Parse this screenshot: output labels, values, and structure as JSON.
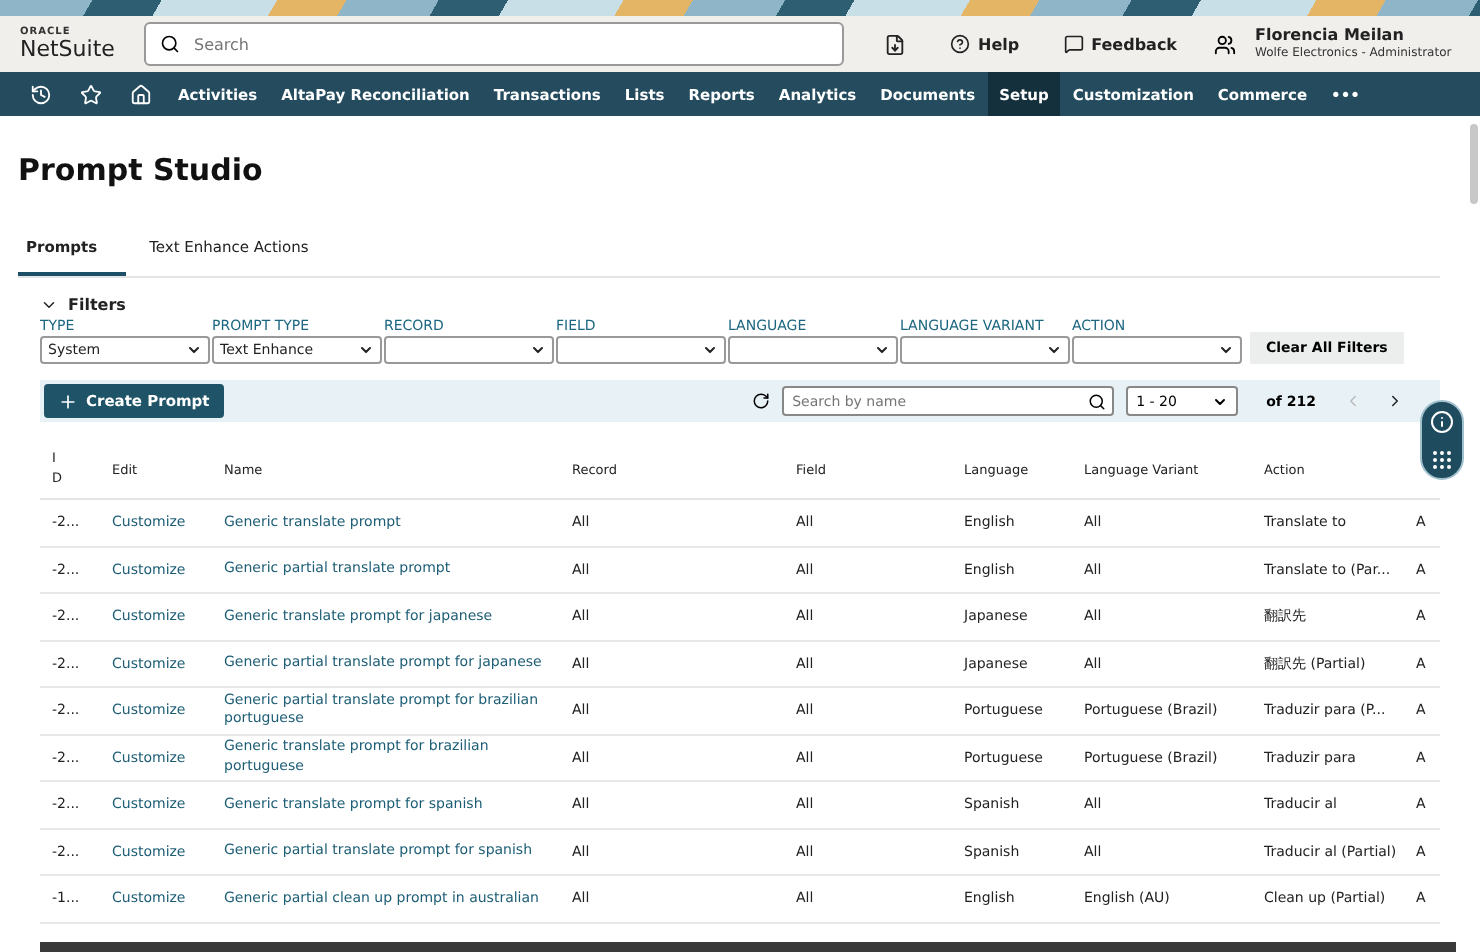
{
  "header": {
    "logo_top": "ORACLE",
    "logo": "NetSuite",
    "search": {
      "placeholder": "Search"
    },
    "help": "Help",
    "feedback": "Feedback",
    "user": {
      "name": "Florencia Meilan",
      "role": "Wolfe Electronics - Administrator"
    }
  },
  "nav": {
    "items": [
      {
        "label": "Activities",
        "selected": false
      },
      {
        "label": "AltaPay Reconciliation",
        "selected": false
      },
      {
        "label": "Transactions",
        "selected": false
      },
      {
        "label": "Lists",
        "selected": false
      },
      {
        "label": "Reports",
        "selected": false
      },
      {
        "label": "Analytics",
        "selected": false
      },
      {
        "label": "Documents",
        "selected": false
      },
      {
        "label": "Setup",
        "selected": true
      },
      {
        "label": "Customization",
        "selected": false
      },
      {
        "label": "Commerce",
        "selected": false
      }
    ],
    "more": "•••"
  },
  "page_title": "Prompt Studio",
  "tabs": [
    {
      "label": "Prompts",
      "selected": true
    },
    {
      "label": "Text Enhance Actions",
      "selected": false
    }
  ],
  "filters": {
    "title": "Filters",
    "expanded": true,
    "fields": [
      {
        "label": "TYPE",
        "value": "System"
      },
      {
        "label": "PROMPT TYPE",
        "value": "Text Enhance"
      },
      {
        "label": "RECORD"
      },
      {
        "label": "FIELD"
      },
      {
        "label": "LANGUAGE"
      },
      {
        "label": "LANGUAGE VARIANT"
      },
      {
        "label": "ACTION"
      }
    ],
    "clear_button": "Clear All Filters"
  },
  "toolbar": {
    "create_button": "Create Prompt",
    "search": {
      "placeholder": "Search by name"
    },
    "page_range": "1 - 20",
    "total": "of 212"
  },
  "table": {
    "columns": [
      "I D",
      "Edit",
      "Name",
      "Record",
      "Field",
      "Language",
      "Language Variant",
      "Action"
    ],
    "rows": [
      [
        "-2...",
        "Customize",
        "Generic translate prompt",
        "All",
        "All",
        "English",
        "All",
        "Translate to",
        "A"
      ],
      [
        "-2...",
        "Customize",
        "Generic partial translate prompt",
        "All",
        "All",
        "English",
        "All",
        "Translate to (Par...",
        "A"
      ],
      [
        "-2...",
        "Customize",
        "Generic translate prompt for japanese",
        "All",
        "All",
        "Japanese",
        "All",
        "翻訳先",
        "A"
      ],
      [
        "-2...",
        "Customize",
        "Generic partial translate prompt for japanese",
        "All",
        "All",
        "Japanese",
        "All",
        "翻訳先 (Partial)",
        "A"
      ],
      [
        "-2...",
        "Customize",
        "Generic partial translate prompt for brazilian portuguese",
        "All",
        "All",
        "Portuguese",
        "Portuguese (Brazil)",
        "Traduzir para (P...",
        "A"
      ],
      [
        "-2...",
        "Customize",
        "Generic translate prompt for brazilian portuguese",
        "All",
        "All",
        "Portuguese",
        "Portuguese (Brazil)",
        "Traduzir para",
        "A"
      ],
      [
        "-2...",
        "Customize",
        "Generic translate prompt for spanish",
        "All",
        "All",
        "Spanish",
        "All",
        "Traducir al",
        "A"
      ],
      [
        "-2...",
        "Customize",
        "Generic partial translate prompt for spanish",
        "All",
        "All",
        "Spanish",
        "All",
        "Traducir al (Partial)",
        "A"
      ],
      [
        "-1...",
        "Customize",
        "Generic partial clean up prompt in australian",
        "All",
        "All",
        "English",
        "English (AU)",
        "Clean up (Partial)",
        "A"
      ]
    ]
  }
}
